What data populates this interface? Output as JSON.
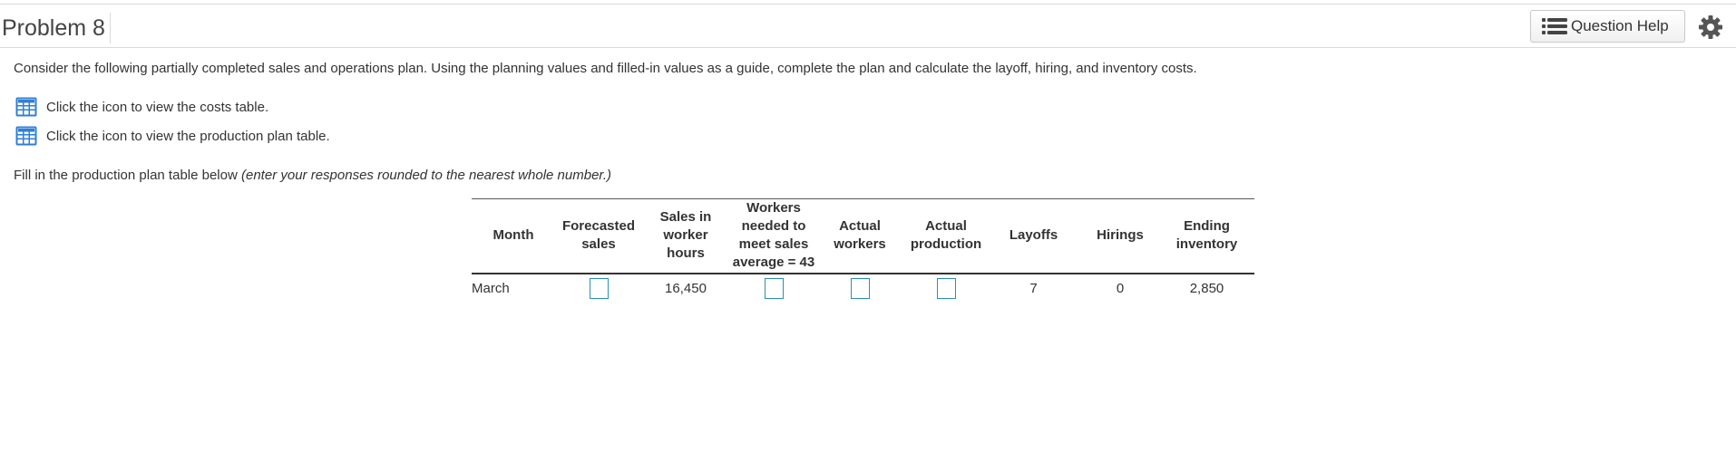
{
  "header": {
    "title": "Problem 8",
    "question_help_label": "Question Help",
    "icons": {
      "help": "list-icon",
      "settings": "gear-icon"
    }
  },
  "intro_text": "Consider the following partially completed sales and operations plan. Using the planning values and filled-in values as a guide, complete the plan and calculate the layoff, hiring, and inventory costs.",
  "links": [
    {
      "icon": "table-grid-icon",
      "label": "Click the icon to view the costs table."
    },
    {
      "icon": "table-grid-icon",
      "label": "Click the icon to view the production plan table."
    }
  ],
  "instruction": {
    "prefix": "Fill in the production plan table below ",
    "italic": "(enter your responses rounded to the nearest whole number.)"
  },
  "table": {
    "headers": {
      "month": "Month",
      "forecasted_sales": [
        "Forecasted",
        "sales"
      ],
      "sales_worker_hours": [
        "Sales in",
        "worker",
        "hours"
      ],
      "workers_needed": [
        "Workers",
        "needed to",
        "meet sales",
        "average = 43"
      ],
      "actual_workers": [
        "Actual",
        "workers"
      ],
      "actual_production": [
        "Actual",
        "production"
      ],
      "layoffs": "Layoffs",
      "hirings": "Hirings",
      "ending_inventory": [
        "Ending",
        "inventory"
      ]
    },
    "row": {
      "month": "March",
      "forecasted_sales": "",
      "sales_worker_hours": "16,450",
      "workers_needed": "",
      "actual_workers": "",
      "actual_production": "",
      "layoffs": "7",
      "hirings": "0",
      "ending_inventory": "2,850"
    }
  },
  "colors": {
    "input_border": "#2a8fb9",
    "icon_blue": "#2f7fd6"
  }
}
